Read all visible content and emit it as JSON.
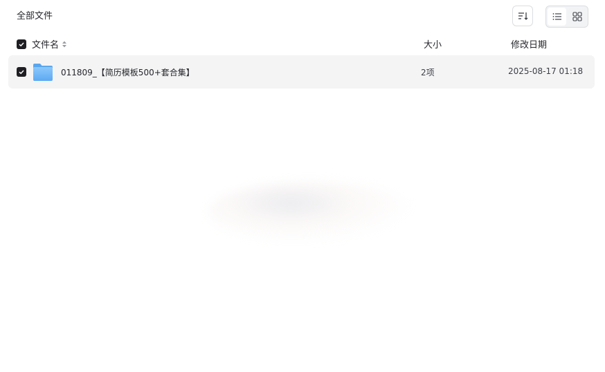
{
  "breadcrumb": {
    "title": "全部文件"
  },
  "toolbar": {
    "sort_icon": "sort-icon",
    "list_view_icon": "list-view-icon",
    "grid_view_icon": "grid-view-icon",
    "active_view": "list"
  },
  "table": {
    "columns": {
      "name": "文件名",
      "size": "大小",
      "modified": "修改日期"
    },
    "rows": [
      {
        "name": "011809_【简历模板500+套合集】",
        "size": "2项",
        "modified": "2025-08-17 01:18",
        "type": "folder",
        "selected": true
      }
    ]
  },
  "colors": {
    "row_bg": "#f4f4f5",
    "checkbox": "#1f1f23",
    "folder": "#6ab4f5"
  }
}
